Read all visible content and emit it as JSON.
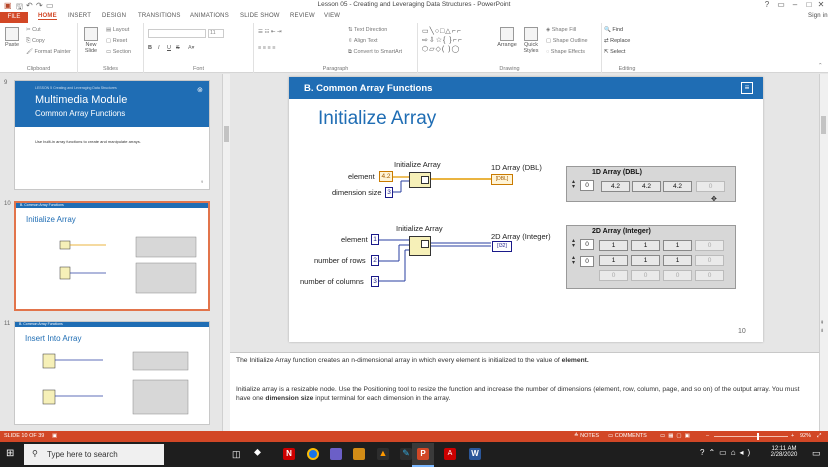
{
  "window": {
    "title": "Lesson 05 - Creating and Leveraging Data Structures - PowerPoint",
    "help": "?",
    "signin": "Sign in"
  },
  "ribbon_tabs": [
    "FILE",
    "HOME",
    "INSERT",
    "DESIGN",
    "TRANSITIONS",
    "ANIMATIONS",
    "SLIDE SHOW",
    "REVIEW",
    "VIEW"
  ],
  "ribbon": {
    "clipboard": {
      "paste": "Paste",
      "cut": "Cut",
      "copy": "Copy",
      "format_painter": "Format Painter",
      "label": "Clipboard"
    },
    "slides": {
      "new_slide": "New Slide",
      "layout": "Layout",
      "reset": "Reset",
      "section": "Section",
      "label": "Slides"
    },
    "font": {
      "size": "11",
      "bold": "B",
      "italic": "I",
      "underline": "U",
      "strike": "S",
      "label": "Font"
    },
    "paragraph": {
      "text_direction": "Text Direction",
      "align_text": "Align Text",
      "convert": "Convert to SmartArt",
      "label": "Paragraph"
    },
    "drawing": {
      "arrange": "Arrange",
      "quick_styles": "Quick Styles",
      "shape_fill": "Shape Fill",
      "shape_outline": "Shape Outline",
      "shape_effects": "Shape Effects",
      "label": "Drawing"
    },
    "editing": {
      "find": "Find",
      "replace": "Replace",
      "select": "Select",
      "label": "Editing"
    }
  },
  "thumbnails": [
    {
      "num": "9",
      "header": "LESSON 5 Creating and Leveraging Data Structures",
      "title": "Multimedia Module",
      "subtitle": "Common Array Functions",
      "body": "Use built-in array functions to create and manipulate arrays."
    },
    {
      "num": "10",
      "header": "B. Common Array Functions",
      "title": "Initialize Array"
    },
    {
      "num": "11",
      "header": "B. Common Array Functions",
      "title": "Insert Into Array"
    }
  ],
  "slide": {
    "header": "B. Common Array Functions",
    "title": "Initialize Array",
    "page": "10",
    "diagram1": {
      "fn_label": "Initialize Array",
      "element_label": "element",
      "element_value": "4.2",
      "dim_label": "dimension size",
      "dim_value": "3",
      "out_label": "1D Array (DBL)",
      "out_term": "[DBL]",
      "panel_title": "1D Array (DBL)",
      "index": "0",
      "cells": [
        "4.2",
        "4.2",
        "4.2",
        "0"
      ]
    },
    "diagram2": {
      "fn_label": "Initialize Array",
      "element_label": "element",
      "element_value": "1",
      "rows_label": "number of rows",
      "rows_value": "2",
      "cols_label": "number of columns",
      "cols_value": "3",
      "out_label": "2D Array (Integer)",
      "out_term": "[I32]",
      "panel_title": "2D Array (Integer)",
      "index_row": "0",
      "index_col": "0",
      "rows": [
        [
          "1",
          "1",
          "1",
          "0"
        ],
        [
          "1",
          "1",
          "1",
          "0"
        ],
        [
          "0",
          "0",
          "0",
          "0"
        ]
      ]
    }
  },
  "notes": {
    "p1_pre": "The Initialize Array function creates an n-dimensional array in which every element is initialized to the value of ",
    "p1_bold": "element.",
    "p2_pre": "Initialize array is a resizable node. Use the Positioning tool to resize the function and increase the number of dimensions (element, row, column, page, and so on) of the output array.  You must have one ",
    "p2_bold": "dimension size",
    "p2_post": " input terminal for each dimension in the array."
  },
  "statusbar": {
    "slide_count": "SLIDE 10 OF 39",
    "notes": "NOTES",
    "comments": "COMMENTS",
    "zoom": "92%"
  },
  "taskbar": {
    "search": "Type here to search",
    "time": "12:11 AM",
    "date": "2/28/2020"
  },
  "colors": {
    "accent": "#d24726",
    "slide_blue": "#1f6db4"
  }
}
